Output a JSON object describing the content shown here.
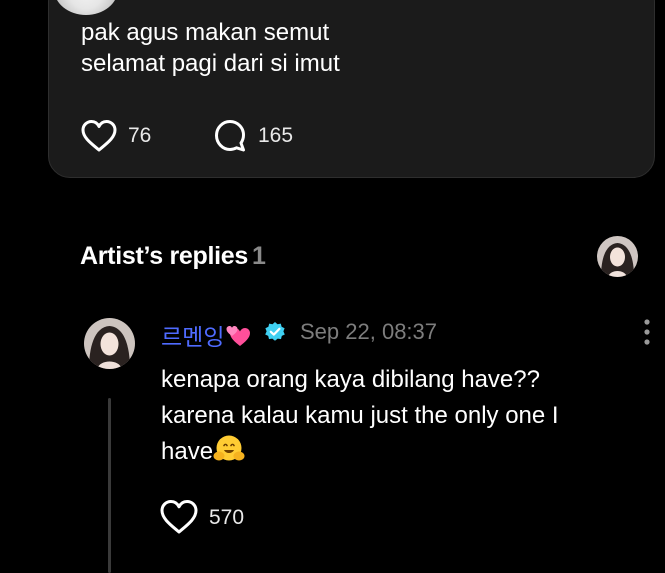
{
  "post": {
    "lines": [
      "pak agus makan semut",
      "selamat pagi dari si imut"
    ],
    "like_count": "76",
    "comment_count": "165"
  },
  "section": {
    "title": "Artist’s replies",
    "count": "1"
  },
  "reply": {
    "author": "르멘잉",
    "timestamp": "Sep 22, 08:37",
    "lines": [
      "kenapa orang kaya dibilang have??",
      "karena kalau kamu just the only one I",
      "have"
    ],
    "like_count": "570"
  },
  "colors": {
    "background": "#000000",
    "card": "#1b1b1b",
    "author_accent": "#4f6bff",
    "verified": "#3fd0f2",
    "muted": "#7d7d7d"
  },
  "icons": {
    "like": "heart-outline-icon",
    "comment": "speech-bubble-icon",
    "verified": "verified-badge-icon",
    "more": "vertical-ellipsis-icon",
    "hearts_emoji": "two-hearts-emoji",
    "hug_emoji": "hugging-face-emoji"
  }
}
